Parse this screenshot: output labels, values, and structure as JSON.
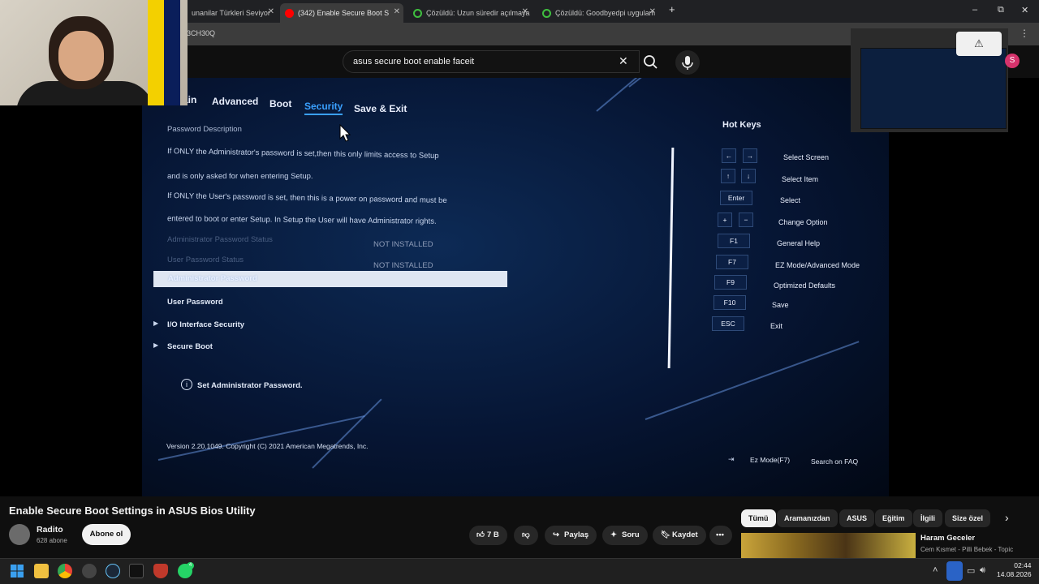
{
  "browser": {
    "tabs": [
      {
        "label": "unanilar Türkleri Seviyor",
        "active": false
      },
      {
        "label": "(342) Enable Secure Boot S",
        "active": true
      },
      {
        "label": "Çözüldü: Uzun süredir açılmaya",
        "active": false
      },
      {
        "label": "Çözüldü: Goodbyedpi uygulam",
        "active": false
      }
    ],
    "new_tab_symbol": "+",
    "window_controls": {
      "minimize": "–",
      "maximize": "⧉",
      "close": "✕"
    },
    "url_fragment": "3CH30Q"
  },
  "youtube": {
    "search_query": "asus secure boot enable faceit",
    "avatar_letter": "S",
    "video": {
      "title": "Enable Secure Boot Settings in ASUS Bios Utility",
      "channel": "Radito",
      "subscribers": "628 abone",
      "subscribe_label": "Abone ol",
      "likes": "7 B",
      "share_label": "Paylaş",
      "ask_label": "Soru",
      "save_label": "Kaydet"
    },
    "chips": [
      "Tümü",
      "Aramanızdan",
      "ASUS",
      "Eğitim",
      "İlgili",
      "Size özel"
    ],
    "recommendation": {
      "title": "Haram Geceler",
      "subtitle": "Cem Kısmet - Pilli Bebek - Topic"
    }
  },
  "bios": {
    "tabs": [
      "ain",
      "Advanced",
      "Boot",
      "Security",
      "Save & Exit"
    ],
    "active_tab": "Security",
    "description_header": "Password Description",
    "description_lines": [
      "If ONLY the Administrator's password is set,then this only limits access to Setup",
      "and is only asked for when entering Setup.",
      "If ONLY the User's password is set, then this is a power on password and must be",
      "entered to boot or enter Setup. In Setup the User will have Administrator rights."
    ],
    "status_rows": [
      {
        "label": "Administrator Password Status",
        "value": "NOT INSTALLED"
      },
      {
        "label": "User Password Status",
        "value": "NOT INSTALLED"
      }
    ],
    "items": [
      {
        "label": "Administrator Password",
        "selected": true
      },
      {
        "label": "User Password",
        "selected": false
      },
      {
        "label": "I/O Interface Security",
        "submenu": true
      },
      {
        "label": "Secure Boot",
        "submenu": true
      }
    ],
    "help_text": "Set Administrator Password.",
    "hotkeys_title": "Hot Keys",
    "hotkeys": [
      {
        "keys": [
          "←",
          "→"
        ],
        "label": "Select Screen"
      },
      {
        "keys": [
          "↑",
          "↓"
        ],
        "label": "Select Item"
      },
      {
        "keys": [
          "Enter"
        ],
        "label": "Select"
      },
      {
        "keys": [
          "+",
          "−"
        ],
        "label": "Change Option"
      },
      {
        "keys": [
          "F1"
        ],
        "label": "General Help"
      },
      {
        "keys": [
          "F7"
        ],
        "label": "EZ Mode/Advanced Mode"
      },
      {
        "keys": [
          "F9"
        ],
        "label": "Optimized Defaults"
      },
      {
        "keys": [
          "F10"
        ],
        "label": "Save"
      },
      {
        "keys": [
          "ESC"
        ],
        "label": "Exit"
      }
    ],
    "footer_version": "Version 2.20.1049. Copyright (C) 2021 American Megatrends, Inc.",
    "footer_ezmode": "Ez Mode(F7)",
    "footer_faq": "Search on FAQ"
  },
  "taskbar": {
    "time": "02:44",
    "date": "14.08.2026",
    "whatsapp_badge": "4"
  }
}
